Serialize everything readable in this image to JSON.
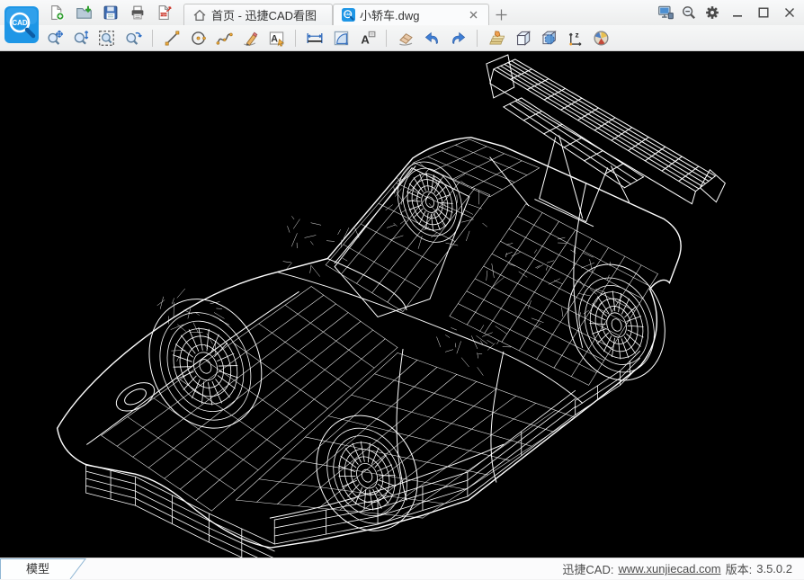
{
  "app": {
    "name": "迅捷CAD看图"
  },
  "colors": {
    "accent": "#1e96e6",
    "canvas_bg": "#000000",
    "wireframe": "#ffffff",
    "chrome": "#f2f3f4"
  },
  "titlebar": {
    "quick_actions": [
      "new-file-icon",
      "open-folder-icon",
      "save-icon",
      "print-icon",
      "export-pdf-icon"
    ],
    "tabs": [
      {
        "label": "首页 - 迅捷CAD看图",
        "icon": "home-icon",
        "active": false
      },
      {
        "label": "小轿车.dwg",
        "icon": "cad-logo-icon",
        "active": true,
        "closable": true
      }
    ],
    "right_icons": [
      "remote-desktop-icon",
      "magnifier-icon",
      "settings-gear-icon"
    ],
    "window_controls": [
      "minimize",
      "maximize",
      "close"
    ]
  },
  "toolbar": {
    "groups": [
      [
        "pan-zoom-icon",
        "zoom-vertical-icon",
        "zoom-window-icon",
        "zoom-previous-icon"
      ],
      [
        "line-tool-icon",
        "circle-tool-icon",
        "spline-tool-icon",
        "pencil-tool-icon",
        "text-edit-icon"
      ],
      [
        "measure-distance-icon",
        "measure-area-icon",
        "text-annotation-icon"
      ],
      [
        "eraser-icon",
        "undo-icon",
        "redo-icon"
      ],
      [
        "layers-icon",
        "box-3d-icon",
        "view-3d-icon",
        "axes-xyz-icon",
        "render-globe-icon"
      ]
    ]
  },
  "canvas": {
    "drawing": "white 3D wireframe sports car with large rear spoiler, front-left three-quarter view on black background"
  },
  "statusbar": {
    "model_tab": "模型",
    "brand": "迅捷CAD:",
    "link": "www.xunjiecad.com",
    "version_label": "版本:",
    "version": "3.5.0.2"
  }
}
